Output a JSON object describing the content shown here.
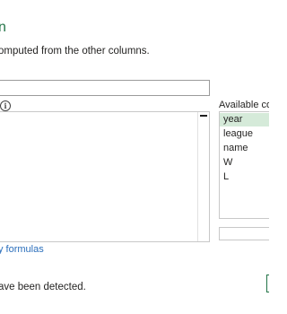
{
  "dialog": {
    "title_fragment": "n",
    "description": "omputed from the other columns.",
    "info_glyph": "i",
    "learn_link": "y formulas",
    "status_text": "ave been detected."
  },
  "available_columns": {
    "label": "Available colu",
    "items": [
      {
        "name": "year",
        "selected": true
      },
      {
        "name": "league",
        "selected": false
      },
      {
        "name": "name",
        "selected": false
      },
      {
        "name": "W",
        "selected": false
      },
      {
        "name": "L",
        "selected": false
      }
    ]
  },
  "colors": {
    "accent": "#217346",
    "selected_row": "#d5ead9",
    "link": "#2a6ebb"
  }
}
